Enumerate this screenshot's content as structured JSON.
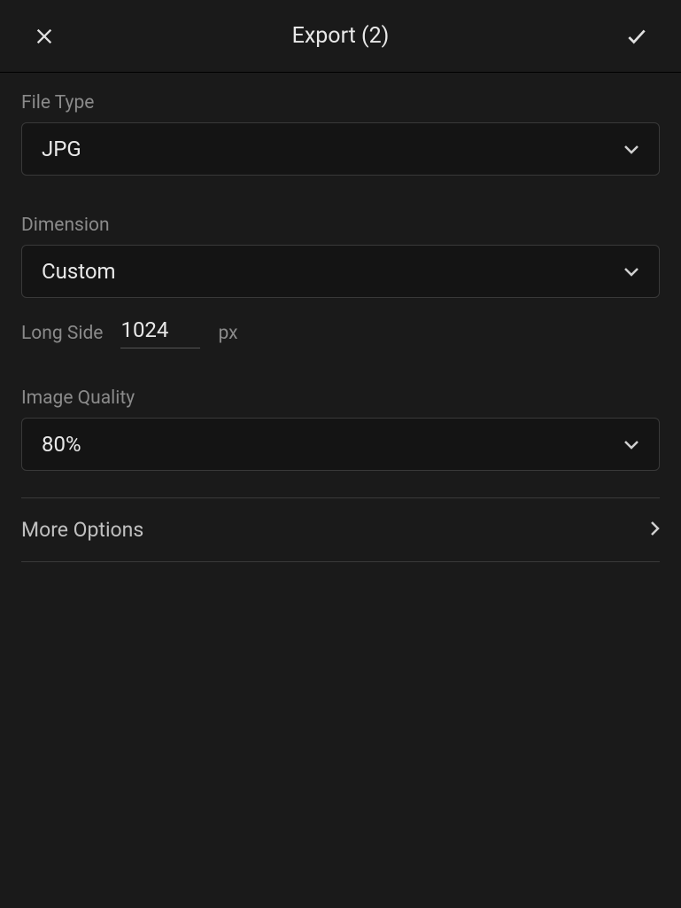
{
  "header": {
    "title": "Export (2)"
  },
  "fileType": {
    "label": "File Type",
    "value": "JPG"
  },
  "dimension": {
    "label": "Dimension",
    "value": "Custom"
  },
  "longSide": {
    "label": "Long Side",
    "value": "1024",
    "unit": "px"
  },
  "imageQuality": {
    "label": "Image Quality",
    "value": "80%"
  },
  "moreOptions": {
    "label": "More Options"
  }
}
